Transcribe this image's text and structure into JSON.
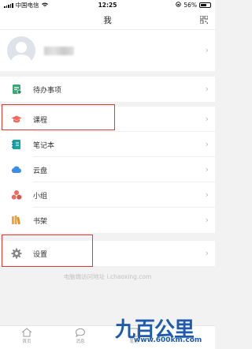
{
  "status_bar": {
    "carrier": "中国电信",
    "time": "12:25",
    "battery": "56%",
    "battery_level": 0.56
  },
  "nav": {
    "title": "我"
  },
  "menu": {
    "todo": "待办事项",
    "course": "课程",
    "notebook": "笔记本",
    "cloud": "云盘",
    "group": "小组",
    "bookshelf": "书架",
    "settings": "设置"
  },
  "footer_hint": "电脑端访问地址 i.chaoxing.com",
  "tabs": {
    "home": "首页",
    "message": "消息",
    "third": "笔记"
  },
  "watermark": {
    "logo": "九百公里",
    "url": "www.600km.com"
  },
  "colors": {
    "highlight": "#e53935",
    "todo_icon": "#39a978",
    "course_icon": "#f0695a",
    "notebook_icon": "#17a2a8",
    "cloud_icon": "#3a8ee6",
    "group_icon": "#ef6a5e",
    "bookshelf_icon": "#f2a23c",
    "settings_icon": "#888888"
  }
}
